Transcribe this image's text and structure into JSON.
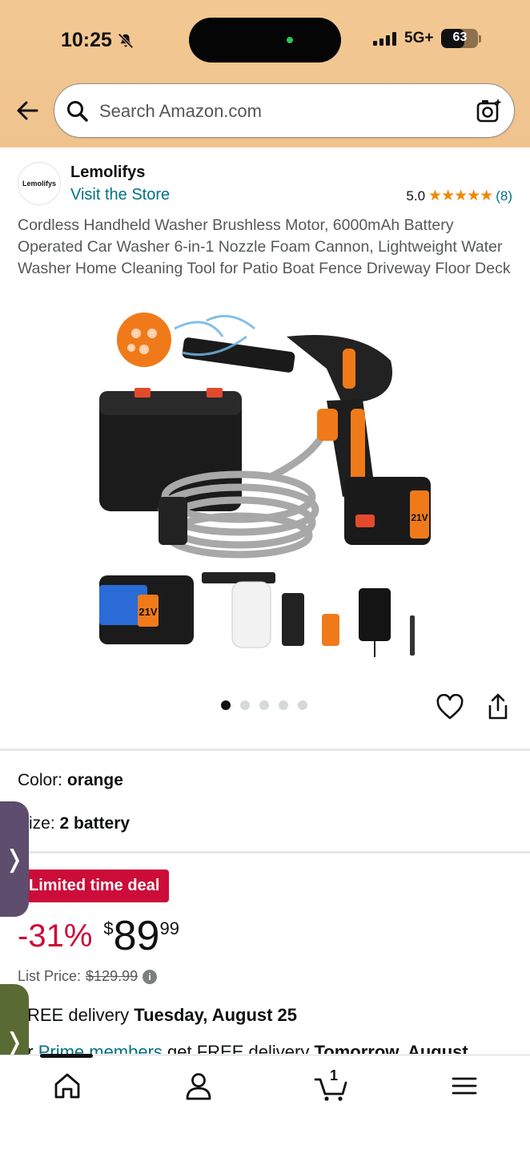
{
  "status_bar": {
    "time": "10:25",
    "network": "5G+",
    "battery": "63"
  },
  "search": {
    "placeholder": "Search Amazon.com"
  },
  "store": {
    "logo_text": "Lemolifys",
    "name": "Lemolifys",
    "link": "Visit the Store",
    "rating_value": "5.0",
    "stars": "★★★★★",
    "rating_count": "(8)"
  },
  "product": {
    "title": "Cordless Handheld Washer Brushless Motor, 6000mAh Battery Operated Car Washer 6-in-1 Nozzle Foam Cannon, Lightweight Water Washer Home Cleaning Tool for Patio Boat Fence Driveway Floor Deck",
    "image_text_battery": "21V",
    "image_dots": 5,
    "image_active_dot": 0
  },
  "variations": {
    "color_label": "Color:",
    "color_value": "orange",
    "size_label": "ize:",
    "size_value": "2 battery"
  },
  "pricing": {
    "deal_badge": "Limited time deal",
    "discount": "-31%",
    "currency": "$",
    "whole": "89",
    "fraction": "99",
    "list_price_label": "List Price:",
    "list_price": "$129.99",
    "info_icon": "i"
  },
  "delivery": {
    "prefix": "REE delivery ",
    "date": "Tuesday, August 25",
    "prime_prefix": "or ",
    "prime_link": "Prime members",
    "prime_suffix": " get FREE delivery ",
    "prime_date": "Tomorrow, August"
  },
  "side_tabs": {
    "chevron": "❭"
  },
  "bottom_nav": {
    "cart_count": "1",
    "items": [
      "home-icon",
      "account-icon",
      "cart-icon",
      "menu-icon"
    ]
  },
  "colors": {
    "header_bg": "#f3c893",
    "link": "#007185",
    "deal": "#cc0c39",
    "star": "#f08804"
  }
}
